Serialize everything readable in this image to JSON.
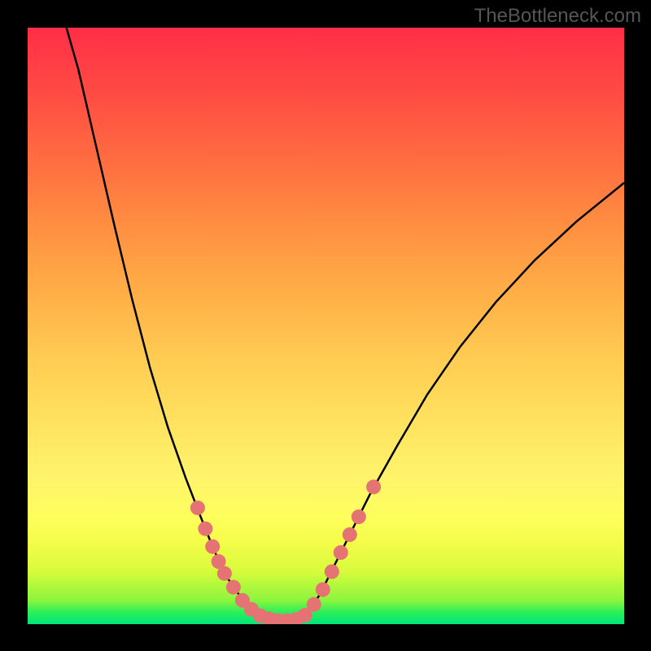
{
  "watermark": "TheBottleneck.com",
  "chart_data": {
    "type": "line",
    "title": "",
    "xlabel": "",
    "ylabel": "",
    "xlim": [
      0,
      100
    ],
    "ylim": [
      0,
      100
    ],
    "curve_points": [
      {
        "x": 6.5,
        "y": 100
      },
      {
        "x": 8.5,
        "y": 93
      },
      {
        "x": 11.5,
        "y": 80
      },
      {
        "x": 14.5,
        "y": 67
      },
      {
        "x": 17.5,
        "y": 54.5
      },
      {
        "x": 20.5,
        "y": 43
      },
      {
        "x": 23.5,
        "y": 33
      },
      {
        "x": 26.5,
        "y": 24.5
      },
      {
        "x": 29.0,
        "y": 18
      },
      {
        "x": 31.0,
        "y": 13
      },
      {
        "x": 33.0,
        "y": 8.5
      },
      {
        "x": 35.0,
        "y": 5.5
      },
      {
        "x": 37.0,
        "y": 3.0
      },
      {
        "x": 39.0,
        "y": 1.3
      },
      {
        "x": 41.0,
        "y": 0.6
      },
      {
        "x": 43.0,
        "y": 0.5
      },
      {
        "x": 45.0,
        "y": 0.6
      },
      {
        "x": 47.0,
        "y": 2.0
      },
      {
        "x": 49.0,
        "y": 5.0
      },
      {
        "x": 51.0,
        "y": 9.0
      },
      {
        "x": 54.0,
        "y": 15.0
      },
      {
        "x": 57.5,
        "y": 22.0
      },
      {
        "x": 62.0,
        "y": 30.0
      },
      {
        "x": 67.0,
        "y": 38.5
      },
      {
        "x": 72.5,
        "y": 46.5
      },
      {
        "x": 78.5,
        "y": 54.0
      },
      {
        "x": 85.0,
        "y": 61.0
      },
      {
        "x": 92.0,
        "y": 67.5
      },
      {
        "x": 100.0,
        "y": 74.0
      }
    ],
    "marker_points": [
      {
        "x": 28.5,
        "y": 19.5
      },
      {
        "x": 29.8,
        "y": 16.0
      },
      {
        "x": 31.0,
        "y": 13.0
      },
      {
        "x": 32.0,
        "y": 10.5
      },
      {
        "x": 33.0,
        "y": 8.5
      },
      {
        "x": 34.5,
        "y": 6.2
      },
      {
        "x": 36.0,
        "y": 4.0
      },
      {
        "x": 37.5,
        "y": 2.5
      },
      {
        "x": 39.0,
        "y": 1.4
      },
      {
        "x": 40.5,
        "y": 0.9
      },
      {
        "x": 42.0,
        "y": 0.6
      },
      {
        "x": 43.5,
        "y": 0.6
      },
      {
        "x": 45.0,
        "y": 0.8
      },
      {
        "x": 46.5,
        "y": 1.5
      },
      {
        "x": 48.0,
        "y": 3.3
      },
      {
        "x": 49.5,
        "y": 5.8
      },
      {
        "x": 51.0,
        "y": 8.8
      },
      {
        "x": 52.5,
        "y": 12.0
      },
      {
        "x": 54.0,
        "y": 15.0
      },
      {
        "x": 55.5,
        "y": 18.0
      },
      {
        "x": 58.0,
        "y": 23.0
      }
    ]
  }
}
